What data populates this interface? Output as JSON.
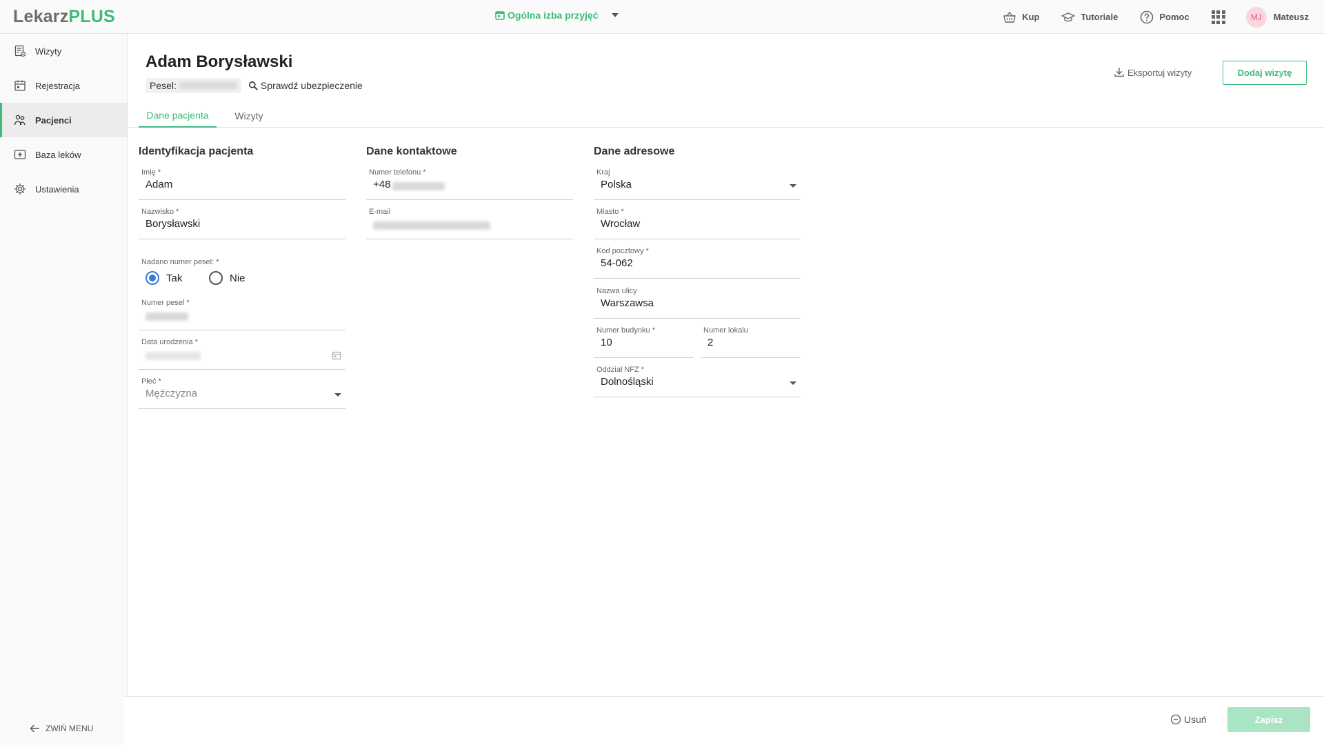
{
  "brand": {
    "part1": "Lekarz",
    "part2": "PLUS"
  },
  "topbar": {
    "location": "Ogólna izba przyjęć",
    "actions": {
      "buy": "Kup",
      "tutorials": "Tutoriale",
      "help": "Pomoc"
    },
    "user": {
      "initials": "MJ",
      "name": "Mateusz"
    }
  },
  "sidebar": {
    "items": [
      {
        "label": "Wizyty",
        "icon": "visits-icon"
      },
      {
        "label": "Rejestracja",
        "icon": "calendar-icon"
      },
      {
        "label": "Pacjenci",
        "icon": "patients-icon",
        "active": true
      },
      {
        "label": "Baza leków",
        "icon": "medicine-icon"
      },
      {
        "label": "Ustawienia",
        "icon": "gear-icon"
      }
    ],
    "collapse_label": "ZWIŃ MENU"
  },
  "patient": {
    "name": "Adam Borysławski",
    "pesel_label": "Pesel:",
    "check_insurance": "Sprawdź ubezpieczenie"
  },
  "header_actions": {
    "export": "Eksportuj wizyty",
    "add_visit": "Dodaj wizytę"
  },
  "tabs": [
    {
      "label": "Dane pacjenta",
      "active": true
    },
    {
      "label": "Wizyty"
    }
  ],
  "sections": {
    "identification": {
      "title": "Identyfikacja pacjenta",
      "first_name": {
        "label": "Imię *",
        "value": "Adam"
      },
      "last_name": {
        "label": "Nazwisko *",
        "value": "Borysławski"
      },
      "pesel_assigned": {
        "label": "Nadano numer pesel: *",
        "options": [
          "Tak",
          "Nie"
        ],
        "selected": "Tak"
      },
      "pesel_number": {
        "label": "Numer pesel *"
      },
      "birth_date": {
        "label": "Data urodzenia *"
      },
      "gender": {
        "label": "Płeć *",
        "value": "Mężczyzna"
      }
    },
    "contact": {
      "title": "Dane kontaktowe",
      "phone": {
        "label": "Numer telefonu *",
        "prefix": "+48"
      },
      "email": {
        "label": "E-mail"
      }
    },
    "address": {
      "title": "Dane adresowe",
      "country": {
        "label": "Kraj",
        "value": "Polska"
      },
      "city": {
        "label": "Miasto *",
        "value": "Wrocław"
      },
      "postal_code": {
        "label": "Kod pocztowy *",
        "value": "54-062"
      },
      "street": {
        "label": "Nazwa ulicy",
        "value": "Warszawsa"
      },
      "building": {
        "label": "Numer budynku *",
        "value": "10"
      },
      "apartment": {
        "label": "Numer lokalu",
        "value": "2"
      },
      "nfz": {
        "label": "Oddział NFZ *",
        "value": "Dolnośląski"
      }
    }
  },
  "footer": {
    "delete": "Usuń",
    "save": "Zapisz"
  },
  "colors": {
    "accent": "#3dbb7a",
    "radio": "#3a7bd5",
    "save_disabled": "#a9e4c5",
    "avatar_bg": "#fbd6df"
  }
}
